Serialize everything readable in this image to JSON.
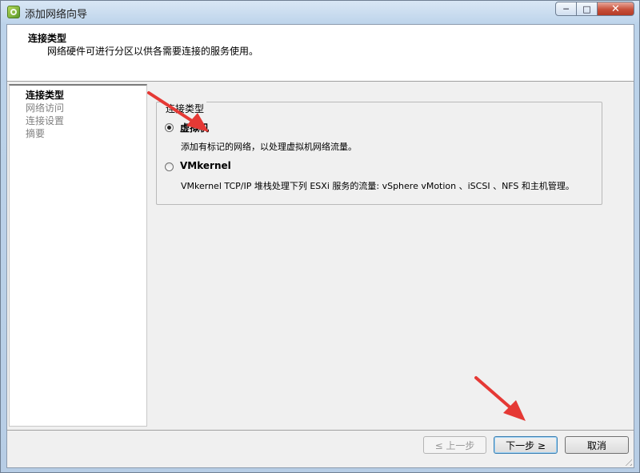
{
  "window": {
    "title": "添加网络向导",
    "controls": {
      "minimize": "─",
      "maximize": "□",
      "close": "✕"
    }
  },
  "header": {
    "title": "连接类型",
    "subtitle": "网络硬件可进行分区以供各需要连接的服务使用。"
  },
  "steps": [
    {
      "label": "连接类型",
      "active": true
    },
    {
      "label": "网络访问",
      "active": false
    },
    {
      "label": "连接设置",
      "active": false
    },
    {
      "label": "摘要",
      "active": false
    }
  ],
  "group": {
    "legend": "连接类型",
    "options": [
      {
        "label": "虚拟机",
        "description": "添加有标记的网络，以处理虚拟机网络流量。",
        "checked": true
      },
      {
        "label": "VMkernel",
        "description": "VMkernel TCP/IP 堆栈处理下列 ESXi 服务的流量: vSphere vMotion 、iSCSI 、NFS 和主机管理。",
        "checked": false
      }
    ]
  },
  "buttons": {
    "back": "≤ 上一步",
    "next": "下一步 ≥",
    "cancel": "取消"
  },
  "colors": {
    "annotation_arrow": "#e53935"
  },
  "icons": {
    "app": "network-wizard-icon",
    "resize": "resize-grip-icon"
  }
}
